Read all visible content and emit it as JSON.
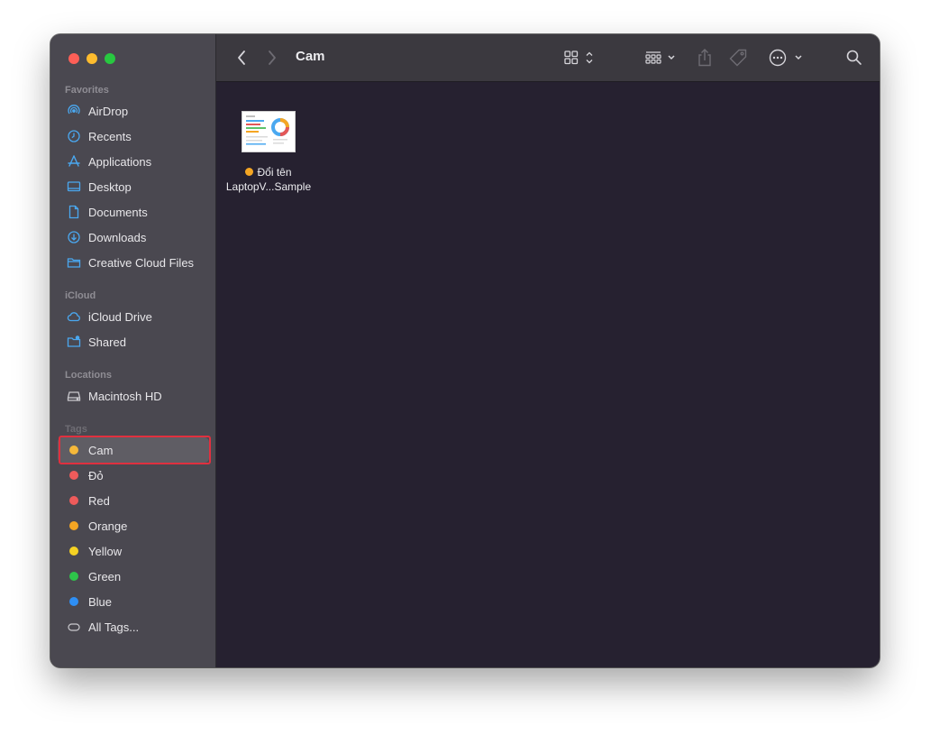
{
  "window": {
    "title": "Cam"
  },
  "toolbar": {
    "back_icon": "chevron-left-icon",
    "forward_icon": "chevron-right-icon",
    "view_icon": "grid-view-icon",
    "group_icon": "group-icon",
    "share_icon": "share-icon",
    "tag_icon": "tag-icon",
    "more_icon": "ellipsis-circle-icon",
    "search_icon": "search-icon"
  },
  "sidebar": {
    "favorites_title": "Favorites",
    "favorites": [
      {
        "label": "AirDrop",
        "icon": "airdrop-icon"
      },
      {
        "label": "Recents",
        "icon": "clock-icon"
      },
      {
        "label": "Applications",
        "icon": "applications-icon"
      },
      {
        "label": "Desktop",
        "icon": "desktop-icon"
      },
      {
        "label": "Documents",
        "icon": "document-icon"
      },
      {
        "label": "Downloads",
        "icon": "download-icon"
      },
      {
        "label": "Creative Cloud Files",
        "icon": "folder-icon"
      }
    ],
    "icloud_title": "iCloud",
    "icloud": [
      {
        "label": "iCloud Drive",
        "icon": "cloud-icon"
      },
      {
        "label": "Shared",
        "icon": "shared-folder-icon"
      }
    ],
    "locations_title": "Locations",
    "locations": [
      {
        "label": "Macintosh HD",
        "icon": "hard-drive-icon"
      }
    ],
    "tags_title": "Tags",
    "tags": [
      {
        "label": "Cam",
        "color": "#f5b83a",
        "selected": true
      },
      {
        "label": "Đỏ",
        "color": "#ee5b5b"
      },
      {
        "label": "Red",
        "color": "#ee5b5b"
      },
      {
        "label": "Orange",
        "color": "#f5a623"
      },
      {
        "label": "Yellow",
        "color": "#f5d223"
      },
      {
        "label": "Green",
        "color": "#2ec54a"
      },
      {
        "label": "Blue",
        "color": "#2e8ff5"
      },
      {
        "label": "All Tags...",
        "color": "",
        "icon": "tag-outline-icon"
      }
    ]
  },
  "files": [
    {
      "name_line1": "Đổi tên",
      "name_line2": "LaptopV...Sample",
      "tag_color": "#f5a623"
    }
  ],
  "colors": {
    "sidebar_bg": "#4a4850",
    "content_bg": "#262130",
    "toolbar_bg": "#3b393f",
    "accent_blue": "#4aa8f0",
    "highlight_red": "#e0303f"
  }
}
